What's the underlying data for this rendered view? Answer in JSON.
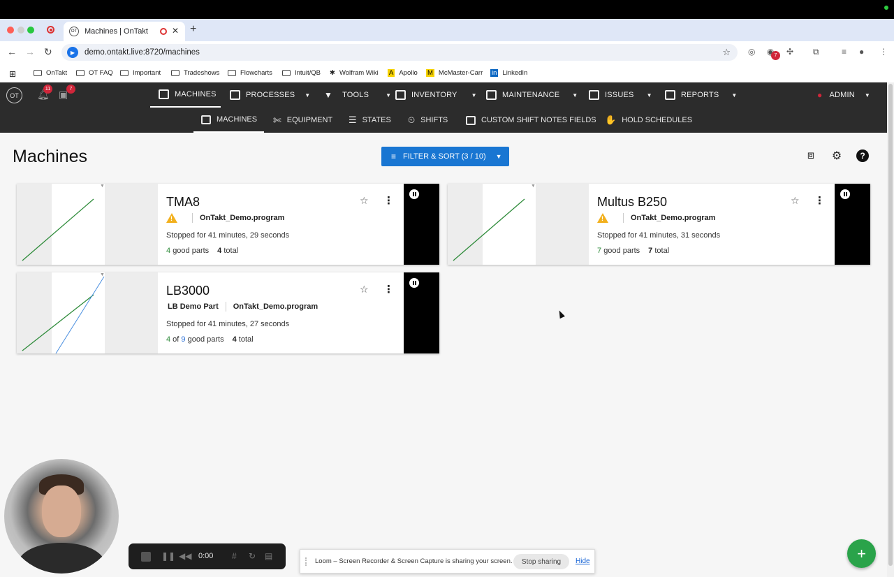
{
  "browser": {
    "tab_title": "Machines | OnTakt",
    "favicon_text": "OT",
    "url": "demo.ontakt.live:8720/machines",
    "bookmarks": [
      "OnTakt",
      "OT FAQ",
      "Important",
      "Tradeshows",
      "Flowcharts",
      "Intuit/QB",
      "Wolfram Wiki",
      "Apollo",
      "McMaster-Carr",
      "LinkedIn"
    ],
    "ext_badge": "7"
  },
  "app": {
    "logo_text": "OT",
    "notifications_count": "11",
    "tasks_count": "7",
    "menu": [
      "MACHINES",
      "PROCESSES",
      "TOOLS",
      "INVENTORY",
      "MAINTENANCE",
      "ISSUES",
      "REPORTS"
    ],
    "user": "ADMIN",
    "submenu": [
      "MACHINES",
      "EQUIPMENT",
      "STATES",
      "SHIFTS",
      "CUSTOM SHIFT NOTES FIELDS",
      "HOLD SCHEDULES"
    ]
  },
  "page": {
    "title": "Machines",
    "filter_label": "FILTER & SORT (3 / 10)"
  },
  "machines": [
    {
      "name": "TMA8",
      "part": "",
      "program": "OnTakt_Demo.program",
      "status": "Stopped for 41 minutes, 29 seconds",
      "good": "4",
      "of_total": "",
      "good_label": "good parts",
      "total": "4",
      "total_label": "total",
      "warning": true
    },
    {
      "name": "Multus B250",
      "part": "",
      "program": "OnTakt_Demo.program",
      "status": "Stopped for 41 minutes, 31 seconds",
      "good": "7",
      "of_total": "",
      "good_label": "good parts",
      "total": "7",
      "total_label": "total",
      "warning": true
    },
    {
      "name": "LB3000",
      "part": "LB Demo Part",
      "program": "OnTakt_Demo.program",
      "status": "Stopped for 41 minutes, 27 seconds",
      "good": "4",
      "of_total": "9",
      "good_label": "good parts",
      "total": "4",
      "total_label": "total",
      "warning": false
    }
  ],
  "loom": {
    "time": "0:00",
    "share_text": "Loom – Screen Recorder & Screen Capture is sharing your screen.",
    "stop_label": "Stop sharing",
    "hide_label": "Hide"
  },
  "fab_label": "+",
  "colors": {
    "header_bg": "#2c2c2c",
    "primary": "#1976d2",
    "good": "#2e8b3a",
    "warn": "#f2b01e",
    "fab": "#2aa34a"
  }
}
